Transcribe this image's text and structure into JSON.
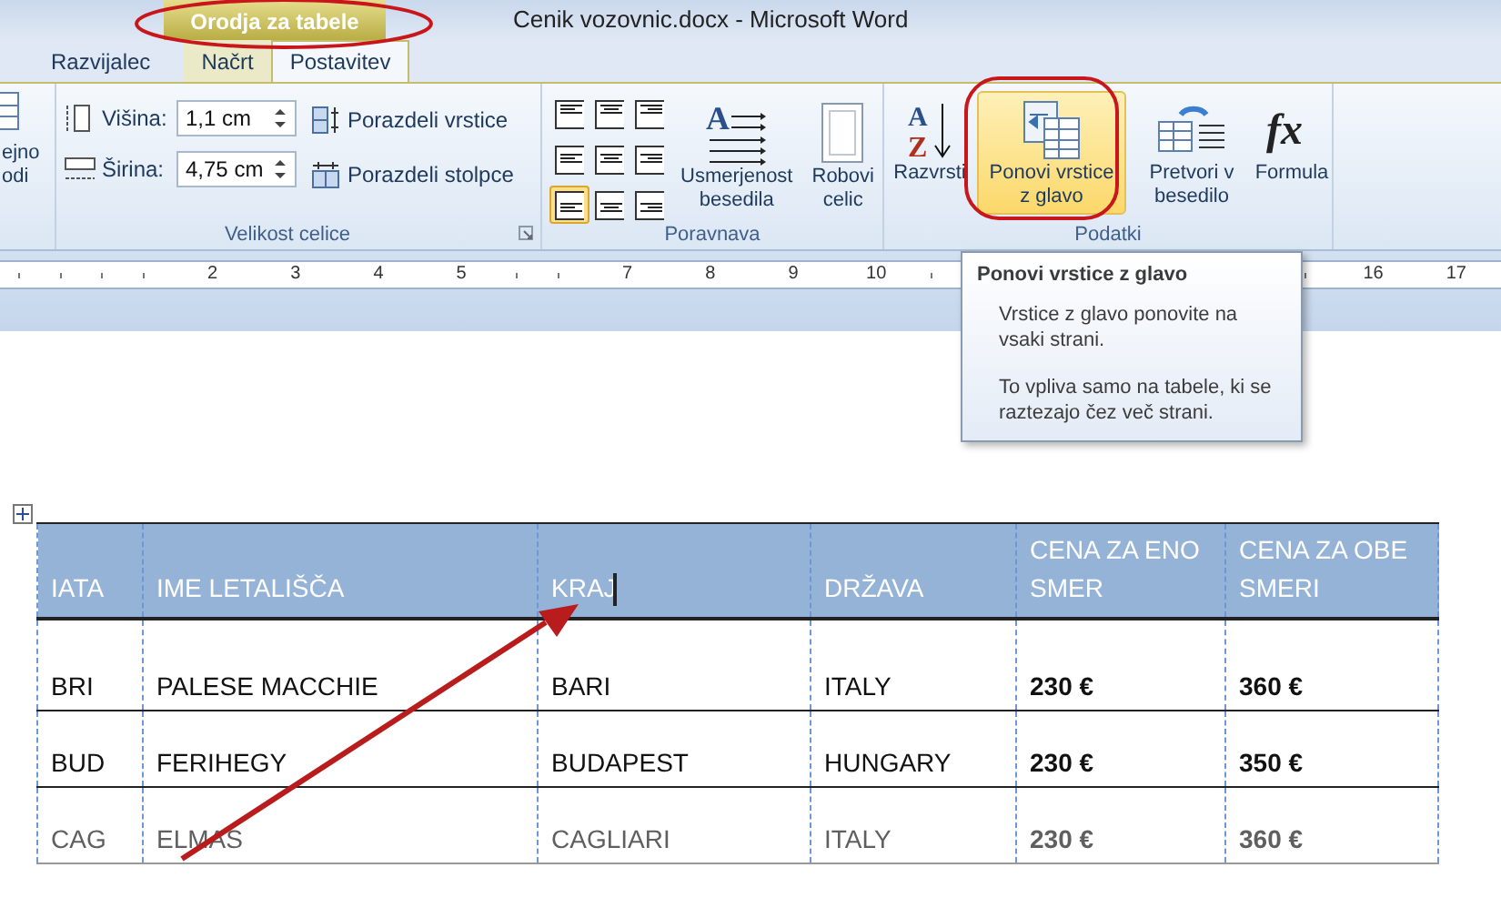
{
  "window": {
    "title": "Cenik vozovnic.docx - Microsoft Word",
    "context_tab": "Orodja za tabele"
  },
  "tabs": [
    {
      "label": "Razvijalec",
      "selected": false
    },
    {
      "label": "Načrt",
      "selected": false
    },
    {
      "label": "Postavitev",
      "selected": true
    }
  ],
  "ribbon": {
    "cut_group": {
      "lines": [
        "ejno",
        "odi"
      ]
    },
    "cell_size": {
      "title": "Velikost celice",
      "height_label": "Višina:",
      "height_value": "1,1 cm",
      "width_label": "Širina:",
      "width_value": "4,75 cm",
      "distribute_rows": "Porazdeli vrstice",
      "distribute_columns": "Porazdeli stolpce"
    },
    "alignment": {
      "title": "Poravnava",
      "buttons": [
        {
          "kind": "topleft",
          "selected": false
        },
        {
          "kind": "topcenter",
          "selected": false
        },
        {
          "kind": "topright",
          "selected": false
        },
        {
          "kind": "middleleft",
          "selected": false
        },
        {
          "kind": "middlecenter",
          "selected": false
        },
        {
          "kind": "middleright",
          "selected": false
        },
        {
          "kind": "bottomleft",
          "selected": true
        },
        {
          "kind": "bottomcenter",
          "selected": false
        },
        {
          "kind": "bottomright",
          "selected": false
        }
      ],
      "text_direction": "Usmerjenost besedila",
      "text_direction_icon_letter": "A",
      "cell_margins": "Robovi celic"
    },
    "data": {
      "title": "Podatki",
      "buttons": [
        {
          "kind": "sort",
          "label": "Razvrsti",
          "icon_letters": [
            "A",
            "Z"
          ],
          "selected": false
        },
        {
          "kind": "repeat",
          "label": "Ponovi vrstice z glavo",
          "selected": true
        },
        {
          "kind": "convert",
          "label": "Pretvori v besedilo",
          "selected": false
        },
        {
          "kind": "formula",
          "label": "Formula",
          "icon_text": "fx",
          "selected": false
        }
      ]
    }
  },
  "ruler": {
    "left_numbers": [
      "2",
      "3",
      "4",
      "5"
    ],
    "middle_numbers": [
      "7",
      "8",
      "9",
      "10"
    ],
    "right_numbers": [
      "16",
      "17"
    ]
  },
  "tooltip": {
    "title": "Ponovi vrstice z glavo",
    "paragraphs": [
      "Vrstice z glavo ponovite na vsaki strani.",
      "To vpliva samo na tabele, ki se raztezajo čez več strani."
    ]
  },
  "table": {
    "columns": [
      "IATA",
      "IME LETALIŠČA",
      "KRAJ",
      "DRŽAVA",
      "CENA ZA ENO SMER",
      "CENA ZA OBE SMERI"
    ],
    "rows": [
      [
        "BRI",
        "PALESE MACCHIE",
        "BARI",
        "ITALY",
        "230 €",
        "360 €"
      ],
      [
        "BUD",
        "FERIHEGY",
        "BUDAPEST",
        "HUNGARY",
        "230 €",
        "350 €"
      ],
      [
        "CAG",
        "ELMAS",
        "CAGLIARI",
        "ITALY",
        "230 €",
        "360 €"
      ]
    ]
  }
}
